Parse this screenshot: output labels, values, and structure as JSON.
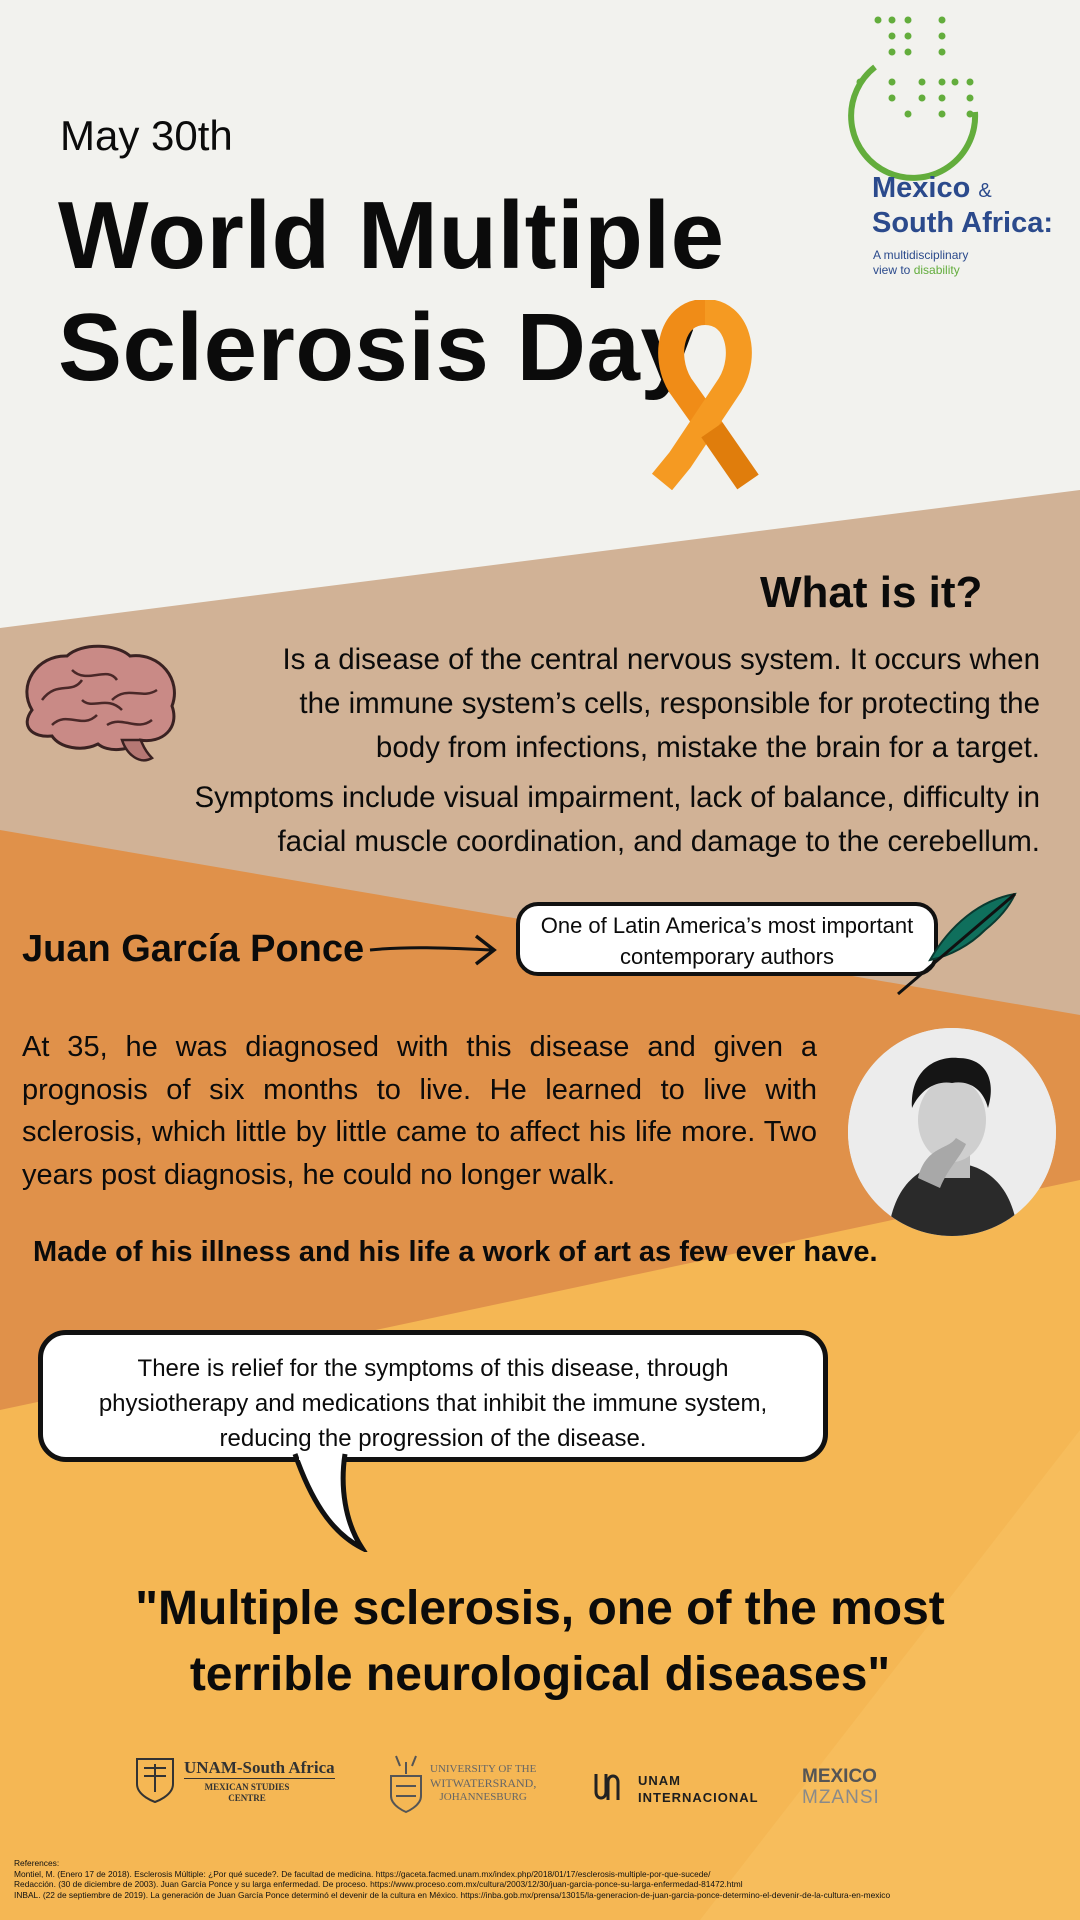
{
  "header": {
    "date": "May 30th",
    "title_line1": "World Multiple",
    "title_line2": "Sclerosis Day"
  },
  "logo": {
    "line1_a": "Mexico",
    "line1_amp": "&",
    "line2": "South Africa:",
    "sub_line1": "A multidisciplinary",
    "sub_line2_a": "view to",
    "sub_line2_b": "disability"
  },
  "what_is_it": {
    "heading": "What is it?",
    "line1": "Is a disease of the central nervous system. It occurs when",
    "line2": "the immune system’s cells, responsible for protecting the",
    "line3": "body from infections, mistake the brain for a target.",
    "line4": "Symptoms include visual impairment, lack of balance, difficulty in",
    "line5": "facial muscle coordination, and damage to the cerebellum."
  },
  "author": {
    "name": "Juan García Ponce",
    "callout_line1": "One of Latin America’s most important",
    "callout_line2": "contemporary authors",
    "story": "At 35, he was diagnosed with this disease and given a prognosis of six months to live. He learned to live with sclerosis, which little by little came to affect his life more. Two years post diagnosis, he could no longer walk.",
    "highlight": "Made of his illness and his life a work of art as few ever have."
  },
  "relief": {
    "line1": "There is relief for the symptoms of this disease, through",
    "line2": "physiotherapy and medications that inhibit the immune system,",
    "line3": "reducing the progression of the disease."
  },
  "quote": {
    "line1": "\"Multiple sclerosis, one of the most",
    "line2": "terrible neurological diseases\""
  },
  "institutions": {
    "unam_title": "UNAM-South Africa",
    "unam_sub1": "Mexican Studies",
    "unam_sub2": "Centre",
    "wits_line1": "UNIVERSITY OF THE",
    "wits_line2": "WITWATERSRAND,",
    "wits_line3": "JOHANNESBURG",
    "intl_line1": "UNAM",
    "intl_line2": "INTERNACIONAL",
    "mz_line1": "MEXICO",
    "mz_line2": "MZANSI"
  },
  "references": {
    "label": "References:",
    "ref1": "Montiel, M. (Enero 17 de 2018). Esclerosis Múltiple: ¿Por qué sucede?. De facultad de medicina. https://gaceta.facmed.unam.mx/index.php/2018/01/17/esclerosis-multiple-por-que-sucede/",
    "ref2": "Redacción. (30 de diciembre de 2003). Juan García Ponce y su larga enfermedad. De proceso. https://www.proceso.com.mx/cultura/2003/12/30/juan-garcia-ponce-su-larga-enfermedad-81472.html",
    "ref3": "INBAL. (22 de septiembre de 2019). La generación de Juan García Ponce determinó el devenir de la cultura en México. https://inba.gob.mx/prensa/13015/la-generacion-de-juan-garcia-ponce-determino-el-devenir-de-la-cultura-en-mexico"
  },
  "colors": {
    "background_top": "#f2f2ee",
    "band_tan": "#d1b296",
    "band_orange": "#e0914a",
    "band_yellow": "#f5b754",
    "ribbon_orange": "#f08c17",
    "logo_blue": "#2b4a8c",
    "logo_green": "#63ad3c"
  },
  "icons": [
    "orange-ribbon-icon",
    "brain-icon",
    "quill-icon",
    "arrow-right-icon",
    "braille-dots-icon"
  ]
}
